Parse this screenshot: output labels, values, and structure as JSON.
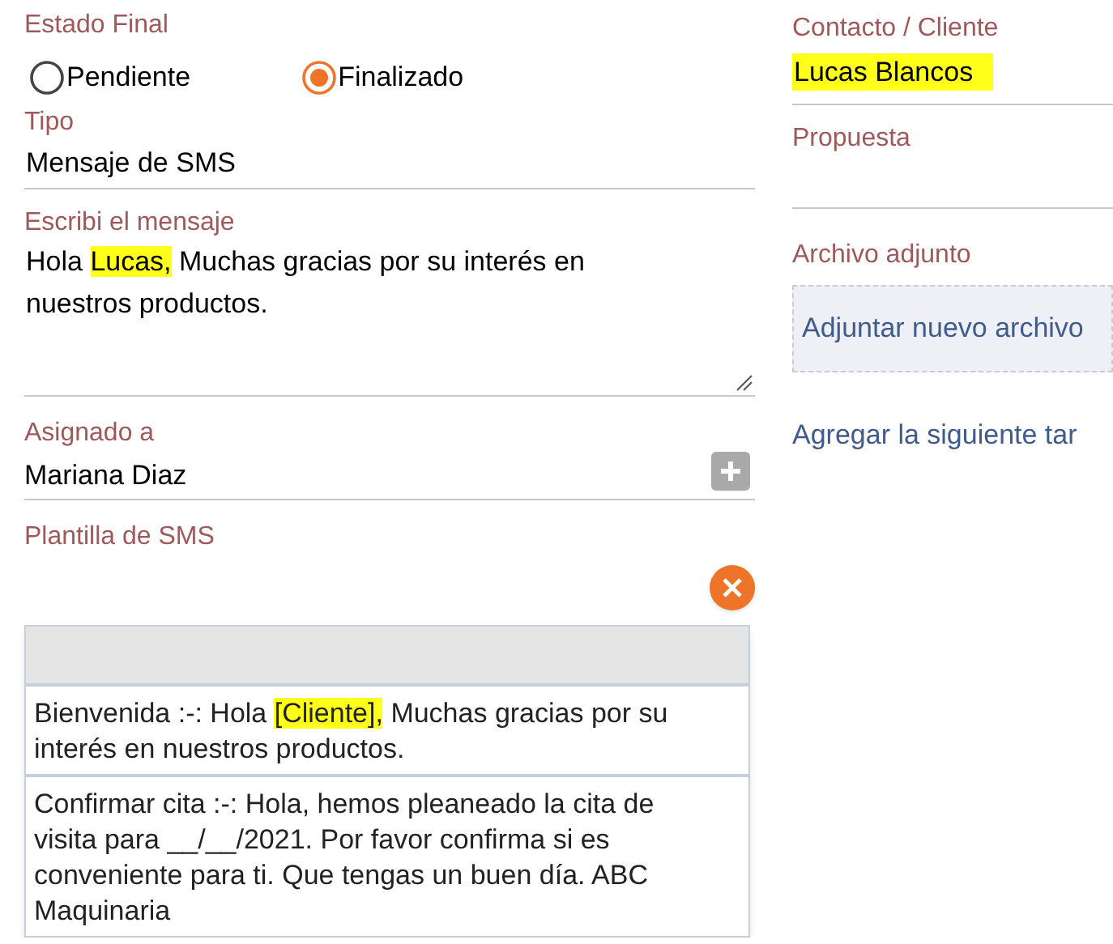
{
  "estado_final": {
    "label": "Estado Final",
    "options": [
      {
        "label": "Pendiente",
        "selected": false
      },
      {
        "label": "Finalizado",
        "selected": true
      }
    ]
  },
  "tipo": {
    "label": "Tipo",
    "value": "Mensaje de SMS"
  },
  "mensaje": {
    "label": "Escribi el mensaje",
    "segments": [
      {
        "text": "Hola ",
        "highlighted": false
      },
      {
        "text": "Lucas,",
        "highlighted": true
      },
      {
        "text": " Muchas gracias por su interés en nuestros productos.",
        "highlighted": false
      }
    ]
  },
  "asignado": {
    "label": "Asignado a",
    "value": "Mariana Diaz"
  },
  "plantilla": {
    "label": "Plantilla de SMS",
    "options": [
      {
        "segments": [
          {
            "text": "Bienvenida :-: Hola ",
            "highlighted": false
          },
          {
            "text": "[Cliente],",
            "highlighted": true
          },
          {
            "text": " Muchas gracias por su interés en nuestros productos.",
            "highlighted": false
          }
        ]
      },
      {
        "segments": [
          {
            "text": "Confirmar cita :-: Hola, hemos pleaneado la cita de visita para __/__/2021. Por favor confirma si es conveniente para ti. Que tengas un buen día. ABC Maquinaria",
            "highlighted": false
          }
        ]
      }
    ]
  },
  "contacto": {
    "label": "Contacto / Cliente",
    "value": "Lucas Blancos",
    "highlighted": true
  },
  "propuesta": {
    "label": "Propuesta"
  },
  "archivo": {
    "label": "Archivo adjunto",
    "button": "Adjuntar nuevo archivo"
  },
  "siguiente_tarea": "Agregar la siguiente tar"
}
